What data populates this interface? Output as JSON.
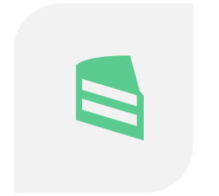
{
  "app_tile": {
    "background": "#f2f2f2"
  },
  "icon": {
    "name": "cake-slice-icon",
    "fill": "#5bcb8f",
    "stripe": "#f2f2f2"
  }
}
